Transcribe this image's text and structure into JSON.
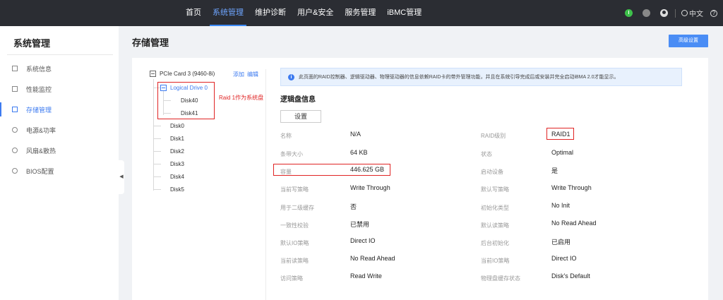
{
  "topnav": {
    "items": [
      "首页",
      "系统管理",
      "维护诊断",
      "用户&安全",
      "服务管理",
      "iBMC管理"
    ],
    "active_index": 1,
    "language": "中文"
  },
  "sidebar": {
    "title": "系统管理",
    "items": [
      {
        "label": "系统信息",
        "icon": "info-icon"
      },
      {
        "label": "性能监控",
        "icon": "chart-icon"
      },
      {
        "label": "存储管理",
        "icon": "storage-icon",
        "active": true
      },
      {
        "label": "电源&功率",
        "icon": "power-icon"
      },
      {
        "label": "风扇&散热",
        "icon": "fan-icon"
      },
      {
        "label": "BIOS配置",
        "icon": "gear-icon"
      }
    ]
  },
  "page": {
    "title": "存储管理",
    "advanced_button": "高级设置"
  },
  "tree": {
    "controller": "PCIe Card 3 (9460-8i)",
    "add_link": "添加",
    "edit_link": "编辑",
    "logical_drive": "Logical Drive 0",
    "logical_members": [
      "Disk40",
      "Disk41"
    ],
    "annotation": "Raid 1作为系统盘",
    "disks": [
      "Disk0",
      "Disk1",
      "Disk2",
      "Disk3",
      "Disk4",
      "Disk5"
    ]
  },
  "info_message": "此页面的RAID控制器、逻辑驱动器、物理驱动器的信息依赖RAID卡的带外管理功能，并且在系统引导完成后或安装并完全启动iBMA 2.0才能显示。",
  "logical": {
    "title": "逻辑盘信息",
    "settings_button": "设置",
    "left": [
      {
        "label": "名称",
        "value": "N/A"
      },
      {
        "label": "条带大小",
        "value": "64 KB"
      },
      {
        "label": "容量",
        "value": "446.625 GB"
      },
      {
        "label": "当前写策略",
        "value": "Write Through"
      },
      {
        "label": "用于二级缓存",
        "value": "否"
      },
      {
        "label": "一致性校验",
        "value": "已禁用"
      },
      {
        "label": "默认IO策略",
        "value": "Direct IO"
      },
      {
        "label": "当前读策略",
        "value": "No Read Ahead"
      },
      {
        "label": "访问策略",
        "value": "Read Write"
      }
    ],
    "right": [
      {
        "label": "RAID级别",
        "value": "RAID1"
      },
      {
        "label": "状态",
        "value": "Optimal"
      },
      {
        "label": "启动设备",
        "value": "是"
      },
      {
        "label": "默认写策略",
        "value": "Write Through"
      },
      {
        "label": "初始化类型",
        "value": "No Init"
      },
      {
        "label": "默认读策略",
        "value": "No Read Ahead"
      },
      {
        "label": "后台初始化",
        "value": "已启用"
      },
      {
        "label": "当前IO策略",
        "value": "Direct IO"
      },
      {
        "label": "物理盘缓存状态",
        "value": "Disk's Default"
      }
    ]
  }
}
